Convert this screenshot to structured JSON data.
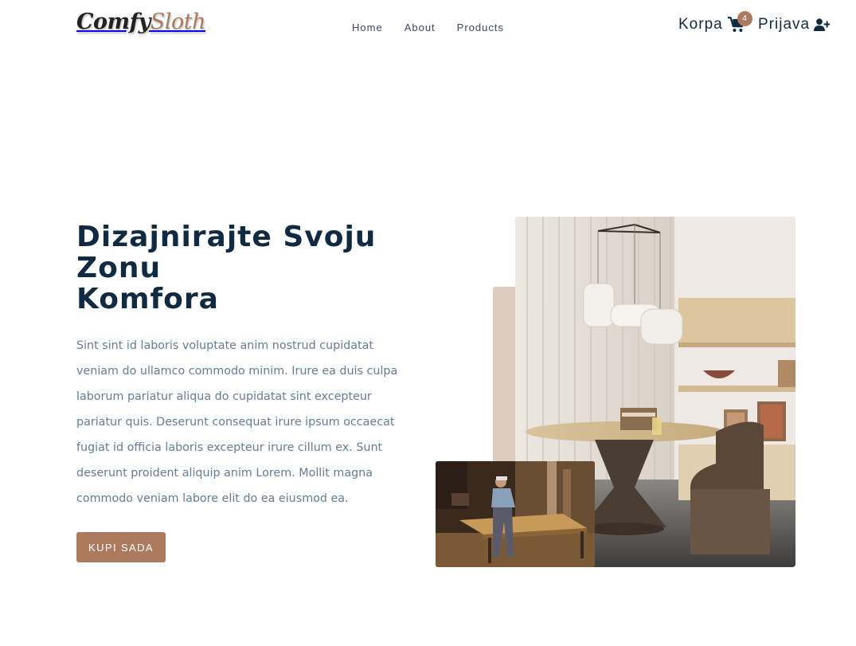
{
  "brand": {
    "part1": "Comfy",
    "part2": "Sloth",
    "accent_color": "#ab7a5f"
  },
  "nav": {
    "links": [
      {
        "label": "Home"
      },
      {
        "label": "About"
      },
      {
        "label": "Products"
      }
    ],
    "cart": {
      "label": "Korpa",
      "count": "4",
      "icon": "cart-icon"
    },
    "login": {
      "label": "Prijava",
      "icon": "user-plus-icon"
    }
  },
  "hero": {
    "title_lines": [
      "Dizajnirajte Svoju",
      "Zonu",
      "Komfora"
    ],
    "text": "Sint sint id laboris voluptate anim nostrud cupidatat veniam do ullamco commodo minim. Irure ea duis culpa laborum pariatur aliqua do cupidatat sint excepteur pariatur quis. Deserunt consequat irure ipsum occaecat fugiat id officia laboris excepteur irure cillum ex. Sunt deserunt proident aliquip anim Lorem. Mollit magna commodo veniam labore elit do ea eiusmod ea.",
    "button_label": "KUPI SADA"
  },
  "colors": {
    "primary_dark": "#102a42",
    "text_muted": "#617d98",
    "accent": "#ab7a5f",
    "accent_light": "#decbc0"
  }
}
